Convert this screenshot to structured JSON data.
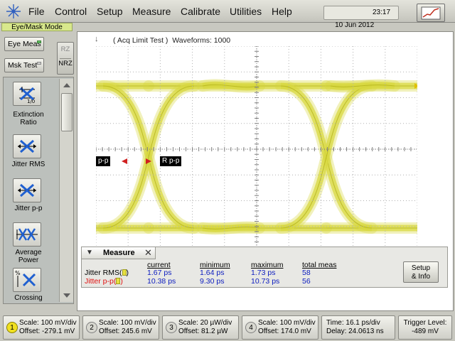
{
  "menubar": {
    "items": [
      "File",
      "Control",
      "Setup",
      "Measure",
      "Calibrate",
      "Utilities",
      "Help"
    ],
    "date": "10 Jun 2012",
    "time": "23:17"
  },
  "left_panel": {
    "mode_title": "Eye/Mask Mode",
    "eye_meas": "Eye Meas",
    "mask_test": "Msk Test",
    "rz": "RZ",
    "nrz": "NRZ",
    "measurements": [
      {
        "icon": "extinction-ratio-icon",
        "label": "Extinction Ratio"
      },
      {
        "icon": "jitter-rms-icon",
        "label": "Jitter RMS"
      },
      {
        "icon": "jitter-pp-icon",
        "label": "Jitter p-p"
      },
      {
        "icon": "average-power-icon",
        "label": "Average Power"
      },
      {
        "icon": "crossing-percentage-icon",
        "label": "Crossing Percentage"
      }
    ],
    "icon_text": {
      "extinction": "1/0",
      "crossing": "%"
    }
  },
  "display": {
    "acq_label": "( Acq Limit Test )  Waveforms: 1000",
    "marker_left": "p-p",
    "marker_right": "R p-p",
    "trace_color": "#d8d840"
  },
  "measure": {
    "title": "Measure",
    "columns": [
      "current",
      "minimum",
      "maximum",
      "total meas"
    ],
    "rows": [
      {
        "name": "Jitter RMS(",
        "name_suffix": ")",
        "name_color": "#000000",
        "current": "1.67 ps",
        "minimum": "1.64 ps",
        "maximum": "1.73 ps",
        "total": "58"
      },
      {
        "name": "Jitter p-p(",
        "name_suffix": ")",
        "name_color": "#e01010",
        "current": "10.38 ps",
        "minimum": "9.30 ps",
        "maximum": "10.73 ps",
        "total": "56"
      }
    ],
    "setup_line1": "Setup",
    "setup_line2": "& Info"
  },
  "statusbar": {
    "channels": [
      {
        "num": "1",
        "scale": "Scale: 100 mV/div",
        "offset": "Offset: -279.1 mV",
        "active": true
      },
      {
        "num": "2",
        "scale": "Scale: 100 mV/div",
        "offset": "Offset: 245.6 mV",
        "active": false
      },
      {
        "num": "3",
        "scale": "Scale: 20 µW/div",
        "offset": "Offset: 81.2 µW",
        "active": false
      },
      {
        "num": "4",
        "scale": "Scale: 100 mV/div",
        "offset": "Offset: 174.0 mV",
        "active": false
      }
    ],
    "time": "Time: 16.1 ps/div",
    "delay": "Delay: 24.0613 ns",
    "trigger_label": "Trigger Level:",
    "trigger_value": "-489 mV"
  }
}
